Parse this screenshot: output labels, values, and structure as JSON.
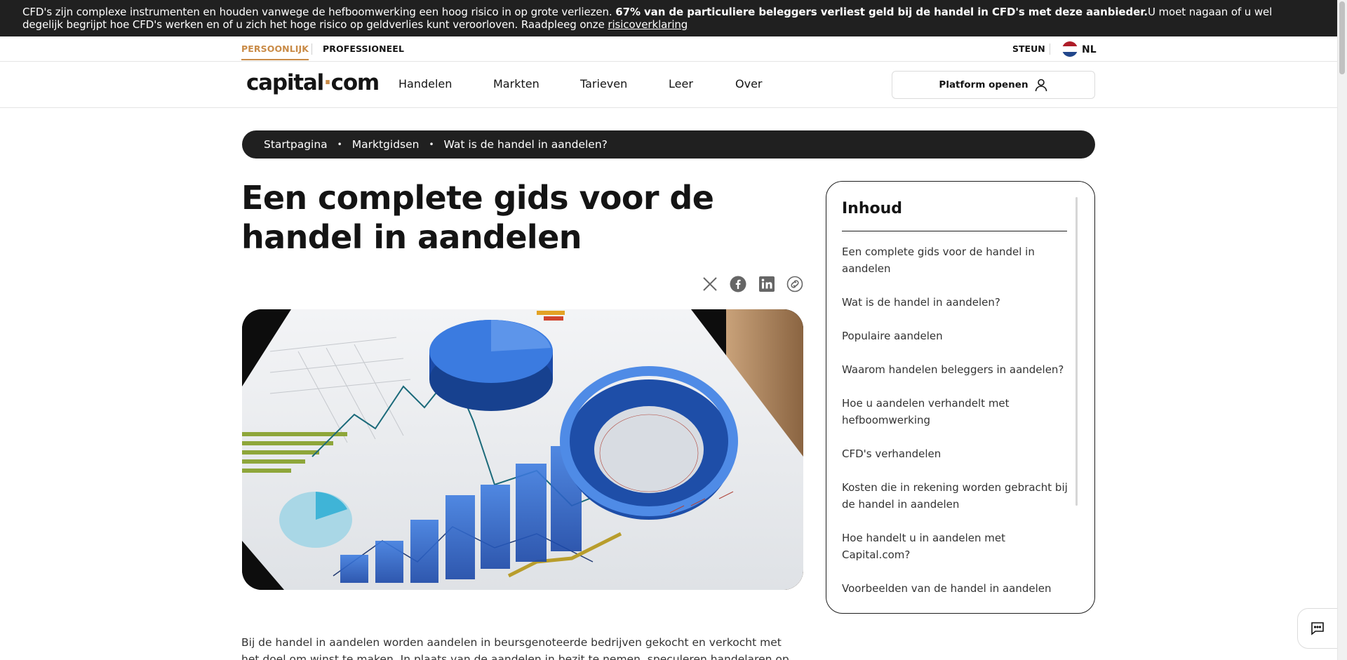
{
  "risk_banner": {
    "text_before": "CFD's zijn complexe instrumenten en houden vanwege de hefboomwerking een hoog risico in op grote verliezen. ",
    "bold": "67% van de particuliere beleggers verliest geld bij de handel in CFD's met deze aanbieder.",
    "text_after": "U moet nagaan of u wel degelijk begrijpt hoe CFD's werken en of u zich het hoge risico op geldverlies kunt veroorloven. Raadpleeg onze ",
    "link": "risicoverklaring"
  },
  "topbar": {
    "personal": "PERSOONLIJK",
    "professional": "PROFESSIONEEL",
    "support": "STEUN",
    "language": "NL"
  },
  "nav": {
    "logo_left": "capital",
    "logo_dot": "·",
    "logo_right": "com",
    "items": [
      "Handelen",
      "Markten",
      "Tarieven",
      "Leer",
      "Over"
    ],
    "platform_button": "Platform openen"
  },
  "breadcrumb": {
    "items": [
      "Startpagina",
      "Marktgidsen",
      "Wat is de handel in aandelen?"
    ],
    "separator": "•"
  },
  "article": {
    "title": "Een complete gids voor de handel in aandelen",
    "share_icons": [
      "x-icon",
      "facebook-icon",
      "linkedin-icon",
      "copy-link-icon"
    ],
    "body": "Bij de handel in aandelen worden aandelen in beursgenoteerde bedrijven gekocht en verkocht met het doel om winst te maken. In plaats van de aandelen in bezit te nemen, speculeren handelaren op hun"
  },
  "toc": {
    "title": "Inhoud",
    "items": [
      "Een complete gids voor de handel in aandelen",
      "Wat is de handel in aandelen?",
      "Populaire aandelen",
      "Waarom handelen beleggers in aandelen?",
      "Hoe u aandelen verhandelt met hefboomwerking",
      "CFD's verhandelen",
      "Kosten die in rekening worden gebracht bij de handel in aandelen",
      "Hoe handelt u in aandelen met Capital.com?",
      "Voorbeelden van de handel in aandelen"
    ]
  },
  "colors": {
    "accent": "#c98b47",
    "dark": "#202020",
    "flag": [
      "#ae1c28",
      "#ffffff",
      "#21468b"
    ]
  }
}
